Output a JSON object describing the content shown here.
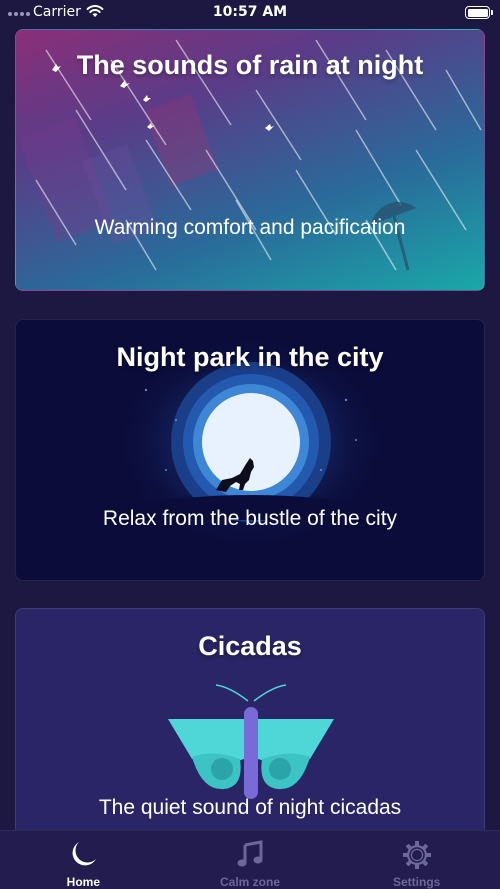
{
  "status_bar": {
    "carrier": "Carrier",
    "time": "10:57 AM"
  },
  "cards": [
    {
      "title": "The sounds of rain at night",
      "subtitle": "Warming comfort and pacification"
    },
    {
      "title": "Night park in the city",
      "subtitle": "Relax from the bustle of the city"
    },
    {
      "title": "Cicadas",
      "subtitle": "The quiet sound of night cicadas"
    }
  ],
  "tab_bar": {
    "active_tab": "Home",
    "tabs": [
      {
        "label": "Home",
        "icon": "moon-icon"
      },
      {
        "label": "Calm zone",
        "icon": "music-note-icon"
      },
      {
        "label": "Settings",
        "icon": "gear-icon"
      }
    ]
  },
  "colors": {
    "background": "#1c1842",
    "tab_bar": "#221d4e",
    "tab_active": "#ffffff",
    "tab_inactive": "#6c6897",
    "rain_card_start": "#8a2f78",
    "rain_card_end": "#1aa8a8",
    "park_card": "#0b0c3a",
    "cicadas_card": "#2a2566",
    "moon": "#e8f2ff",
    "butterfly": "#4fd6d6"
  }
}
